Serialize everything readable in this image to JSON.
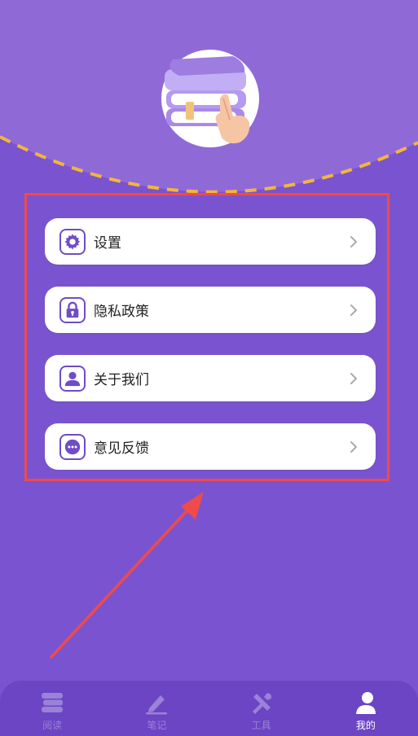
{
  "menu": {
    "items": [
      {
        "label": "设置",
        "icon": "gear-icon"
      },
      {
        "label": "隐私政策",
        "icon": "lock-icon"
      },
      {
        "label": "关于我们",
        "icon": "person-icon"
      },
      {
        "label": "意见反馈",
        "icon": "chat-bubble-icon"
      }
    ]
  },
  "tabbar": {
    "tabs": [
      {
        "label": "阅读",
        "icon": "book-stack-icon",
        "active": false
      },
      {
        "label": "笔记",
        "icon": "pen-icon",
        "active": false
      },
      {
        "label": "工具",
        "icon": "tools-icon",
        "active": false
      },
      {
        "label": "我的",
        "icon": "user-icon",
        "active": true
      }
    ]
  },
  "colors": {
    "background": "#7a54d0",
    "header_arc": "#8f6ad6",
    "dashed_line": "#f3b63c",
    "highlight_box": "#f04a4a",
    "tabbar": "#6b45c4",
    "icon_accent": "#6f4cc9"
  }
}
